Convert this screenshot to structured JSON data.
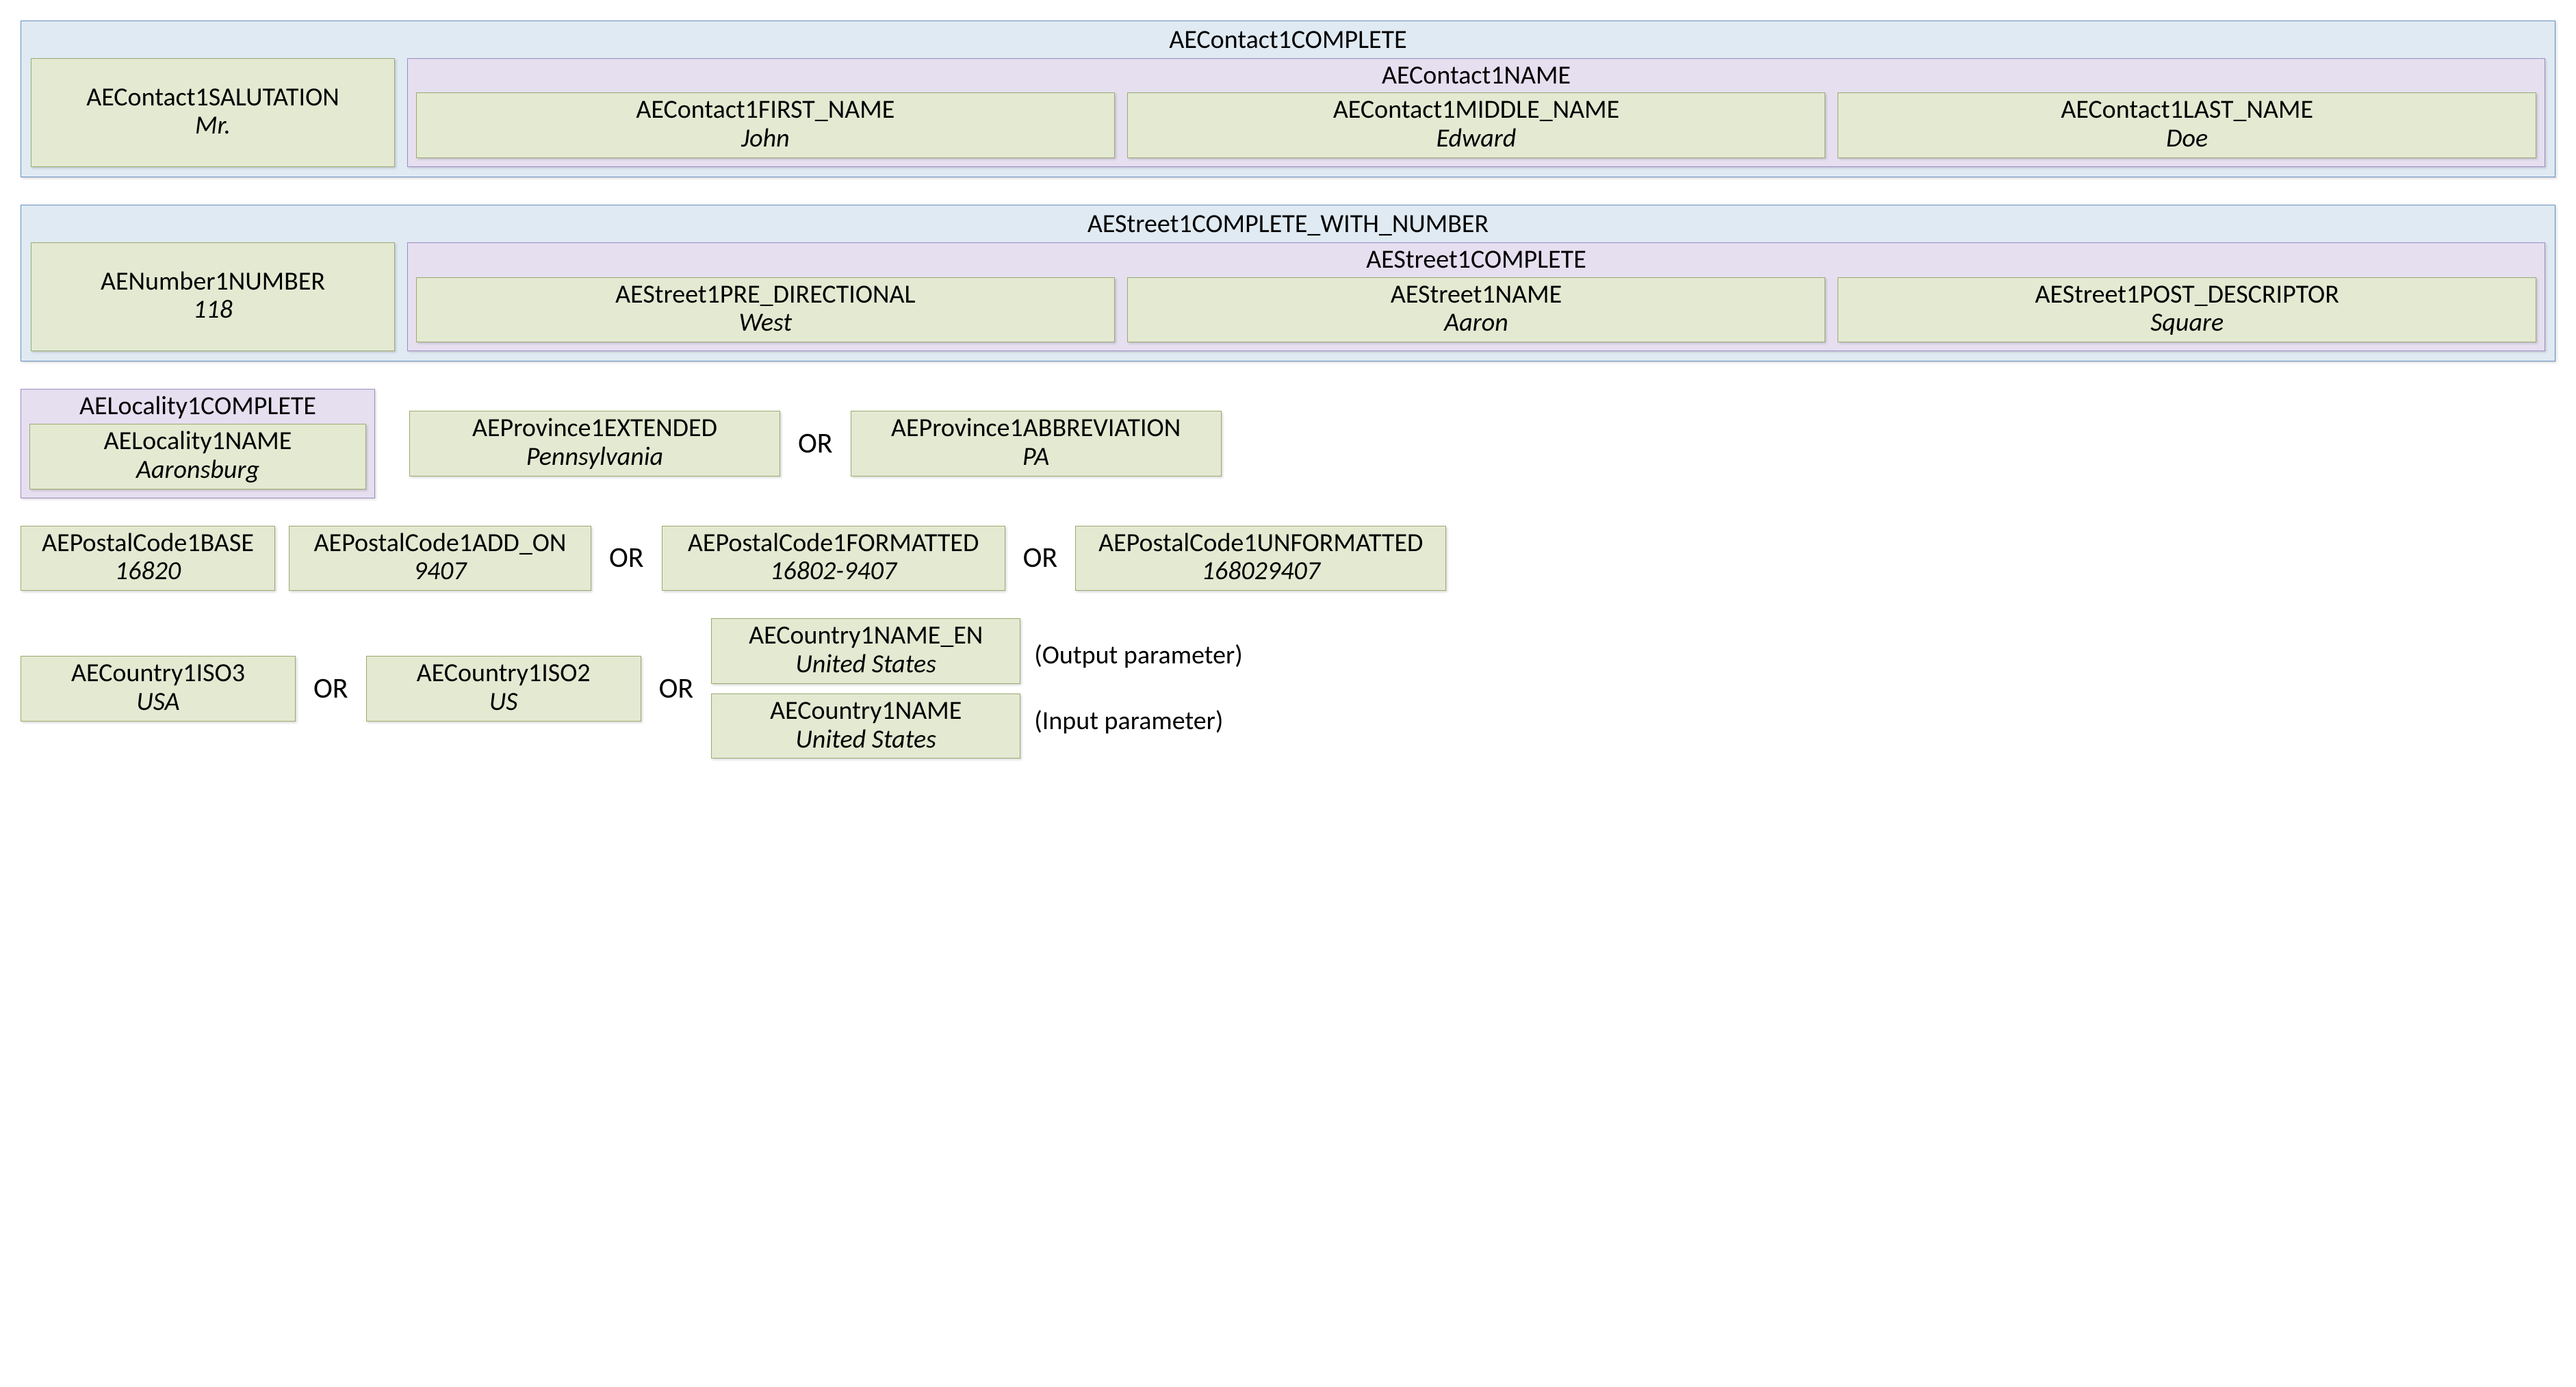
{
  "contact": {
    "complete_label": "AEContact1COMPLETE",
    "name_label": "AEContact1NAME",
    "salutation": {
      "name": "AEContact1SALUTATION",
      "value": "Mr."
    },
    "first": {
      "name": "AEContact1FIRST_NAME",
      "value": "John"
    },
    "middle": {
      "name": "AEContact1MIDDLE_NAME",
      "value": "Edward"
    },
    "last": {
      "name": "AEContact1LAST_NAME",
      "value": "Doe"
    }
  },
  "street": {
    "complete_with_number_label": "AEStreet1COMPLETE_WITH_NUMBER",
    "complete_label": "AEStreet1COMPLETE",
    "number": {
      "name": "AENumber1NUMBER",
      "value": "118"
    },
    "pre_directional": {
      "name": "AEStreet1PRE_DIRECTIONAL",
      "value": "West"
    },
    "street_name": {
      "name": "AEStreet1NAME",
      "value": "Aaron"
    },
    "post_descriptor": {
      "name": "AEStreet1POST_DESCRIPTOR",
      "value": "Square"
    }
  },
  "locality": {
    "complete_label": "AELocality1COMPLETE",
    "name": {
      "name": "AELocality1NAME",
      "value": "Aaronsburg"
    }
  },
  "province": {
    "extended": {
      "name": "AEProvince1EXTENDED",
      "value": "Pennsylvania"
    },
    "abbreviation": {
      "name": "AEProvince1ABBREVIATION",
      "value": "PA"
    }
  },
  "postal": {
    "base": {
      "name": "AEPostalCode1BASE",
      "value": "16820"
    },
    "add_on": {
      "name": "AEPostalCode1ADD_ON",
      "value": "9407"
    },
    "formatted": {
      "name": "AEPostalCode1FORMATTED",
      "value": "16802-9407"
    },
    "unformatted": {
      "name": "AEPostalCode1UNFORMATTED",
      "value": "168029407"
    }
  },
  "country": {
    "iso3": {
      "name": "AECountry1ISO3",
      "value": "USA"
    },
    "iso2": {
      "name": "AECountry1ISO2",
      "value": "US"
    },
    "name_en": {
      "name": "AECountry1NAME_EN",
      "value": "United States"
    },
    "name": {
      "name": "AECountry1NAME",
      "value": "United States"
    },
    "note_output": "(Output parameter)",
    "note_input": "(Input parameter)"
  },
  "labels": {
    "or": "OR"
  }
}
